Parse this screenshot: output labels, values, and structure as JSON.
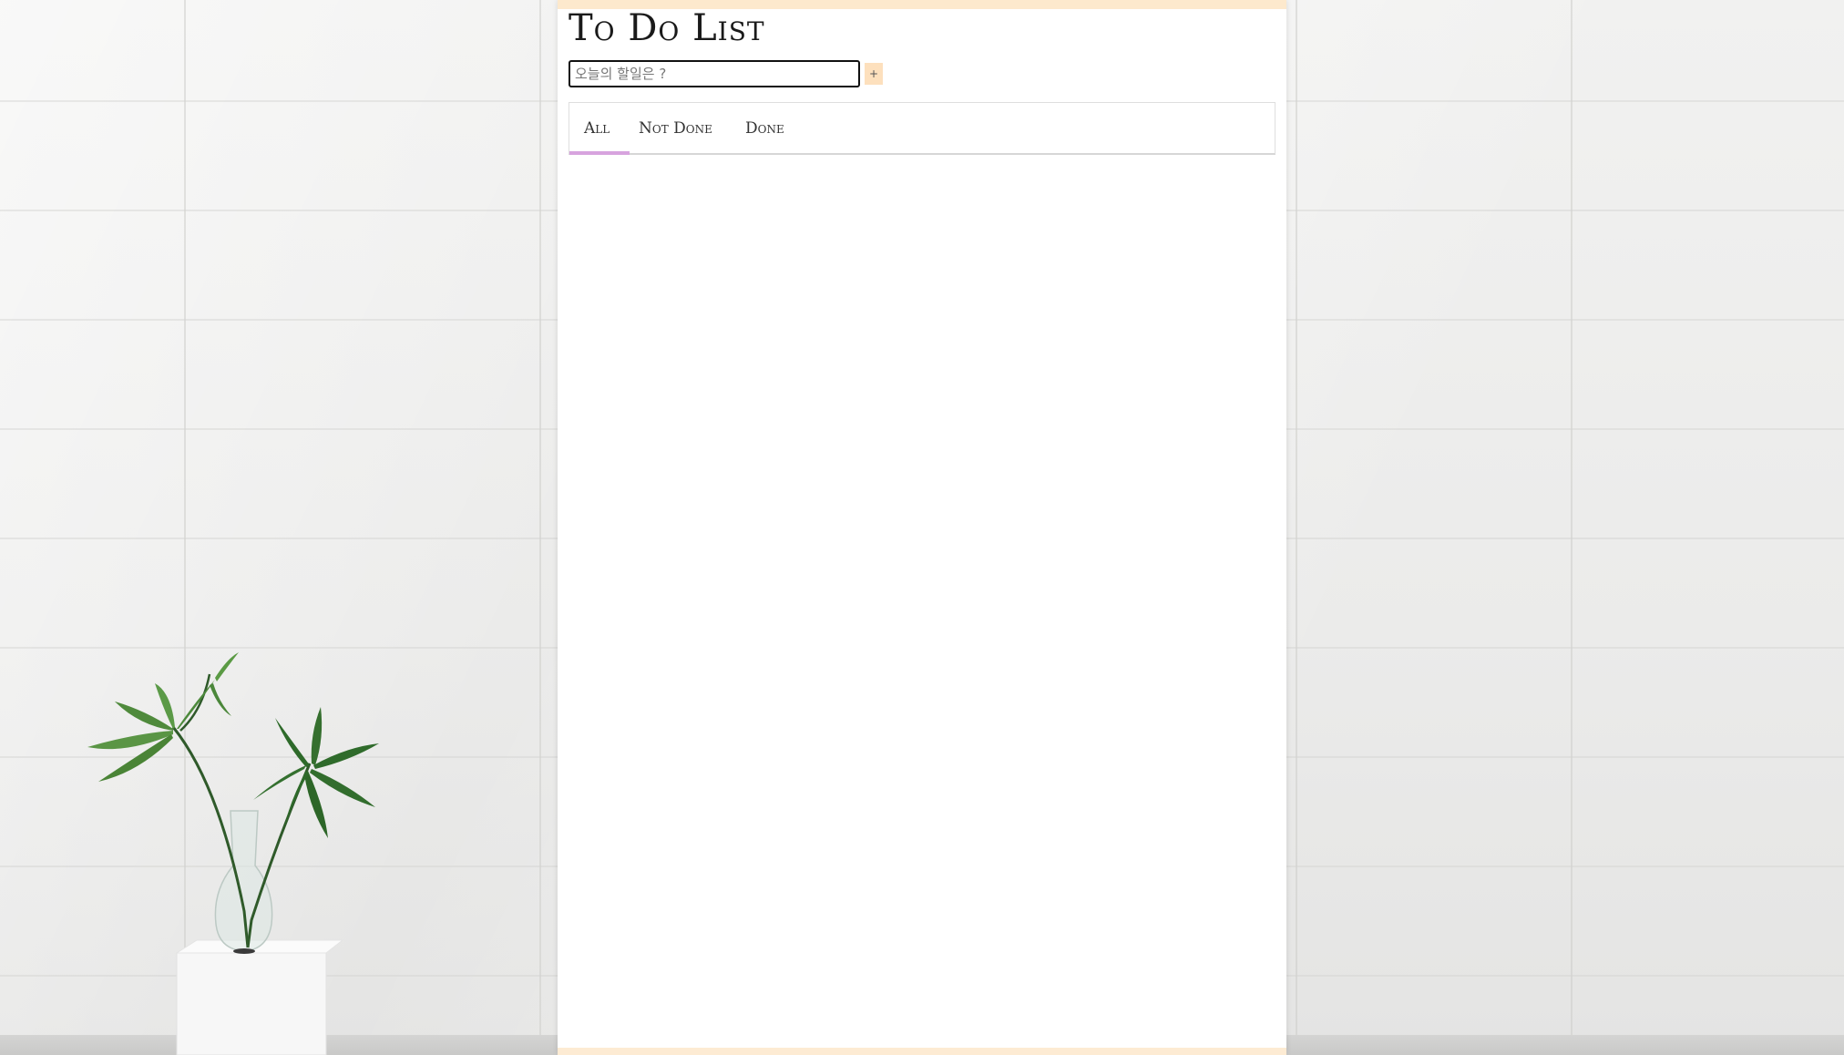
{
  "app": {
    "title": "To Do List"
  },
  "input": {
    "placeholder": "오늘의 할일은 ?",
    "value": ""
  },
  "add_button": {
    "label": "+"
  },
  "tabs": [
    {
      "label": "All",
      "active": true
    },
    {
      "label": "Not Done",
      "active": false
    },
    {
      "label": "Done",
      "active": false
    }
  ],
  "tasks": [],
  "colors": {
    "top_bar": "#fde9cd",
    "add_button": "#fde0bd",
    "tab_underline": "#d7a3de"
  },
  "background": {
    "image": "plant-in-vase"
  }
}
